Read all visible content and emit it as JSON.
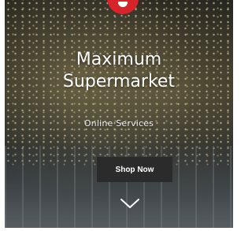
{
  "hero": {
    "title_line1": "Maximum",
    "title_line2": "Supermarket",
    "subtitle": "Online Services",
    "cta_label": "Shop Now",
    "scroll_icon": "chevron-down-icon",
    "logo_icon": "brand-logo"
  },
  "colors": {
    "logo": "#d8232a",
    "button_bg": "#2b2b2b",
    "text": "#ffffff"
  }
}
